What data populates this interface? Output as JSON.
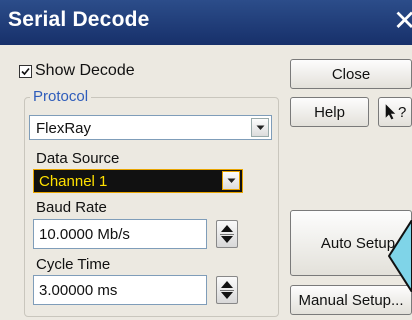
{
  "window": {
    "title": "Serial Decode",
    "close_glyph": "✕"
  },
  "show_decode": {
    "label": "Show Decode",
    "checked": true
  },
  "protocol": {
    "legend": "Protocol",
    "selected": "FlexRay",
    "data_source": {
      "label": "Data Source",
      "selected": "Channel 1",
      "highlight_color": "#2b2b00",
      "text_color": "#ffe000",
      "border_color": "#e8a400"
    },
    "baud_rate": {
      "label": "Baud Rate",
      "value": "10.0000 Mb/s"
    },
    "cycle_time": {
      "label": "Cycle Time",
      "value": "3.00000 ms"
    }
  },
  "buttons": {
    "close": "Close",
    "help": "Help",
    "whats_this": "?",
    "auto_setup": "Auto Setup",
    "manual_setup": "Manual Setup..."
  },
  "colors": {
    "title_bar": "#1f3d7a",
    "legend_text": "#2f5dbb",
    "callout_arrow": "#7fd4e8"
  }
}
